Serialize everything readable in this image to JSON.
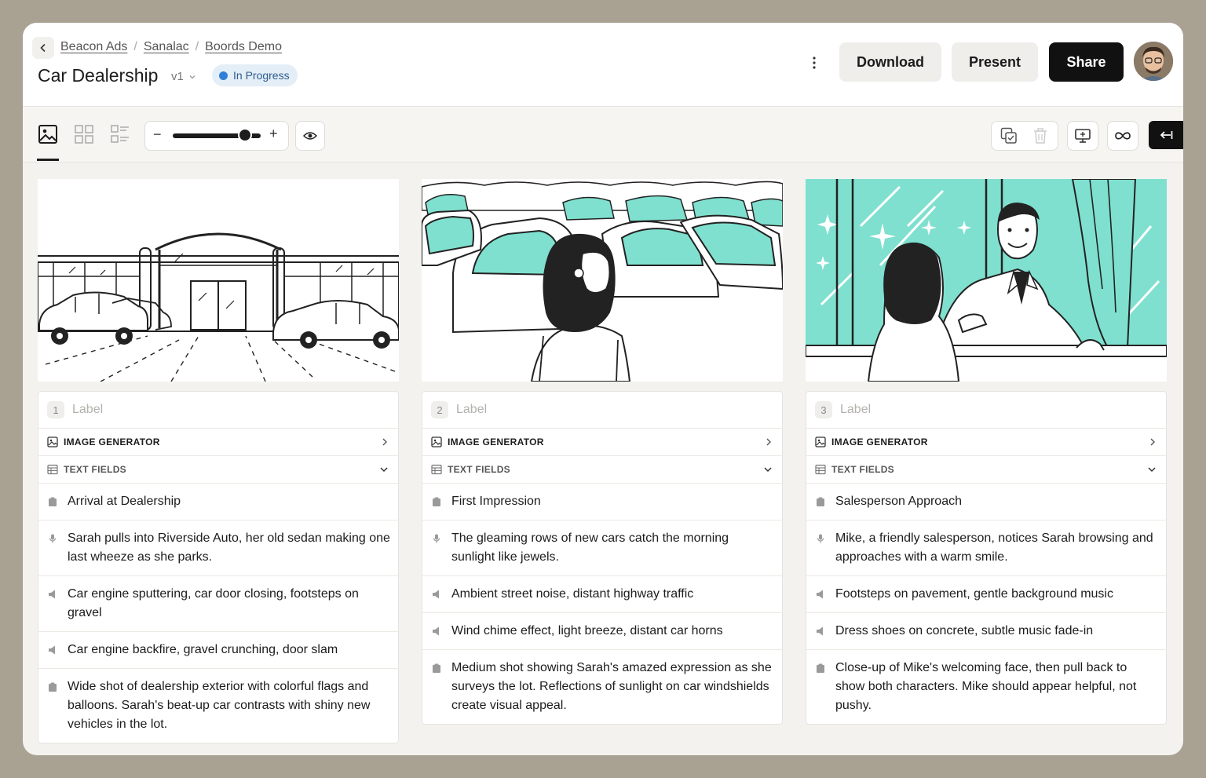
{
  "breadcrumb": [
    "Beacon Ads",
    "Sanalac",
    "Boords Demo"
  ],
  "breadcrumb_separator": "/",
  "title": "Car Dealership",
  "version": "v1",
  "status": {
    "label": "In Progress",
    "color": "#2f7fd8"
  },
  "header_buttons": {
    "download": "Download",
    "present": "Present",
    "share": "Share"
  },
  "toolbar": {
    "zoom_minus": "−",
    "zoom_plus": "+",
    "zoom_level": 0.85,
    "active_view": "image-view"
  },
  "colors": {
    "accent_teal": "#7fe0cf",
    "share_bg": "#111111"
  },
  "frames": [
    {
      "number": "1",
      "label_placeholder": "Label",
      "image_generator": "IMAGE GENERATOR",
      "text_fields_label": "TEXT FIELDS",
      "fields": [
        {
          "icon": "clipboard-icon",
          "text": "Arrival at Dealership"
        },
        {
          "icon": "mic-icon",
          "text": "Sarah pulls into Riverside Auto, her old sedan making one last wheeze as she parks."
        },
        {
          "icon": "speaker-icon",
          "text": "Car engine sputtering, car door closing, footsteps on gravel"
        },
        {
          "icon": "speaker-icon",
          "text": "Car engine backfire, gravel crunching, door slam"
        },
        {
          "icon": "clipboard-icon",
          "text": "Wide shot of dealership exterior with colorful flags and balloons. Sarah's beat-up car contrasts with shiny new vehicles in the lot."
        }
      ]
    },
    {
      "number": "2",
      "label_placeholder": "Label",
      "image_generator": "IMAGE GENERATOR",
      "text_fields_label": "TEXT FIELDS",
      "fields": [
        {
          "icon": "clipboard-icon",
          "text": "First Impression"
        },
        {
          "icon": "mic-icon",
          "text": "The gleaming rows of new cars catch the morning sunlight like jewels."
        },
        {
          "icon": "speaker-icon",
          "text": "Ambient street noise, distant highway traffic"
        },
        {
          "icon": "speaker-icon",
          "text": "Wind chime effect, light breeze, distant car horns"
        },
        {
          "icon": "clipboard-icon",
          "text": "Medium shot showing Sarah's amazed expression as she surveys the lot. Reflections of sunlight on car windshields create visual appeal."
        }
      ]
    },
    {
      "number": "3",
      "label_placeholder": "Label",
      "image_generator": "IMAGE GENERATOR",
      "text_fields_label": "TEXT FIELDS",
      "fields": [
        {
          "icon": "clipboard-icon",
          "text": "Salesperson Approach"
        },
        {
          "icon": "mic-icon",
          "text": "Mike, a friendly salesperson, notices Sarah browsing and approaches with a warm smile."
        },
        {
          "icon": "speaker-icon",
          "text": "Footsteps on pavement, gentle background music"
        },
        {
          "icon": "speaker-icon",
          "text": "Dress shoes on concrete, subtle music fade-in"
        },
        {
          "icon": "clipboard-icon",
          "text": "Close-up of Mike's welcoming face, then pull back to show both characters. Mike should appear helpful, not pushy."
        }
      ]
    }
  ]
}
